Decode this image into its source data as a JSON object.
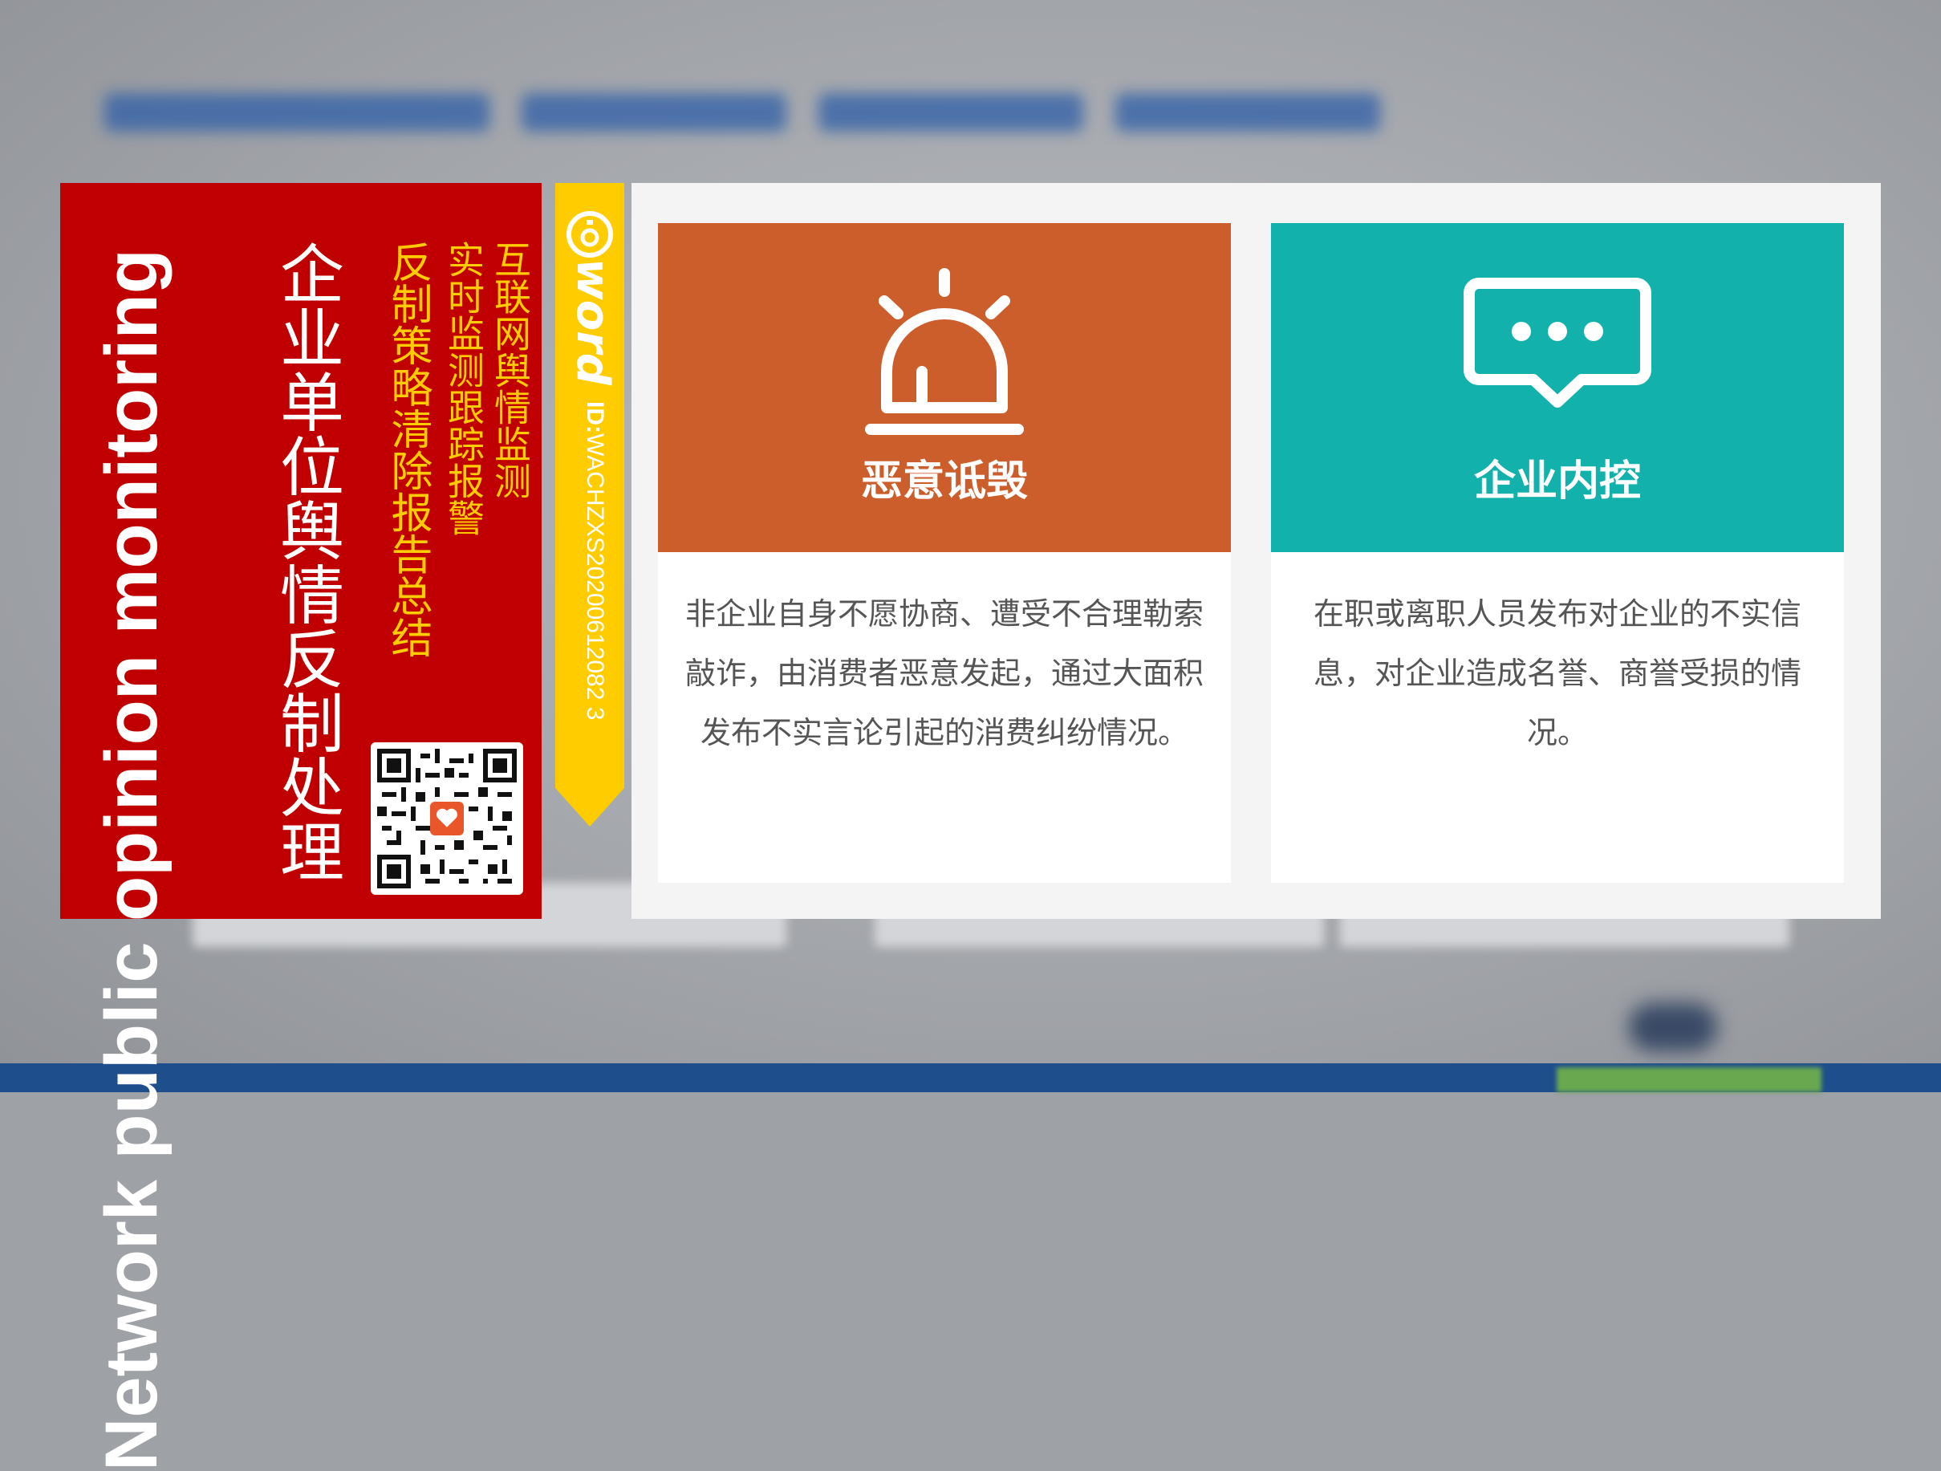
{
  "left_panel": {
    "english_title": "Network public opinion monitoring",
    "chinese_title": "企业单位舆情反制处理",
    "subtitle_lines": [
      "互联网舆情监测",
      "实时监测跟踪报警",
      "反制策略清除报告总结"
    ]
  },
  "ribbon": {
    "brand": "word",
    "id_label": "ID:",
    "id_value": "WACHZXS20200612082 3"
  },
  "cards": [
    {
      "title": "恶意诋毁",
      "icon": "alarm-siren-icon",
      "color": "#cc5e2c",
      "description": "非企业自身不愿协商、遭受不合理勒索敲诈，由消费者恶意发起，通过大面积发布不实言论引起的消费纠纷情况。"
    },
    {
      "title": "企业内控",
      "icon": "chat-bubble-icon",
      "color": "#13b1ac",
      "description": "在职或离职人员发布对企业的不实信息，对企业造成名誉、商誉受损的情况。"
    }
  ]
}
